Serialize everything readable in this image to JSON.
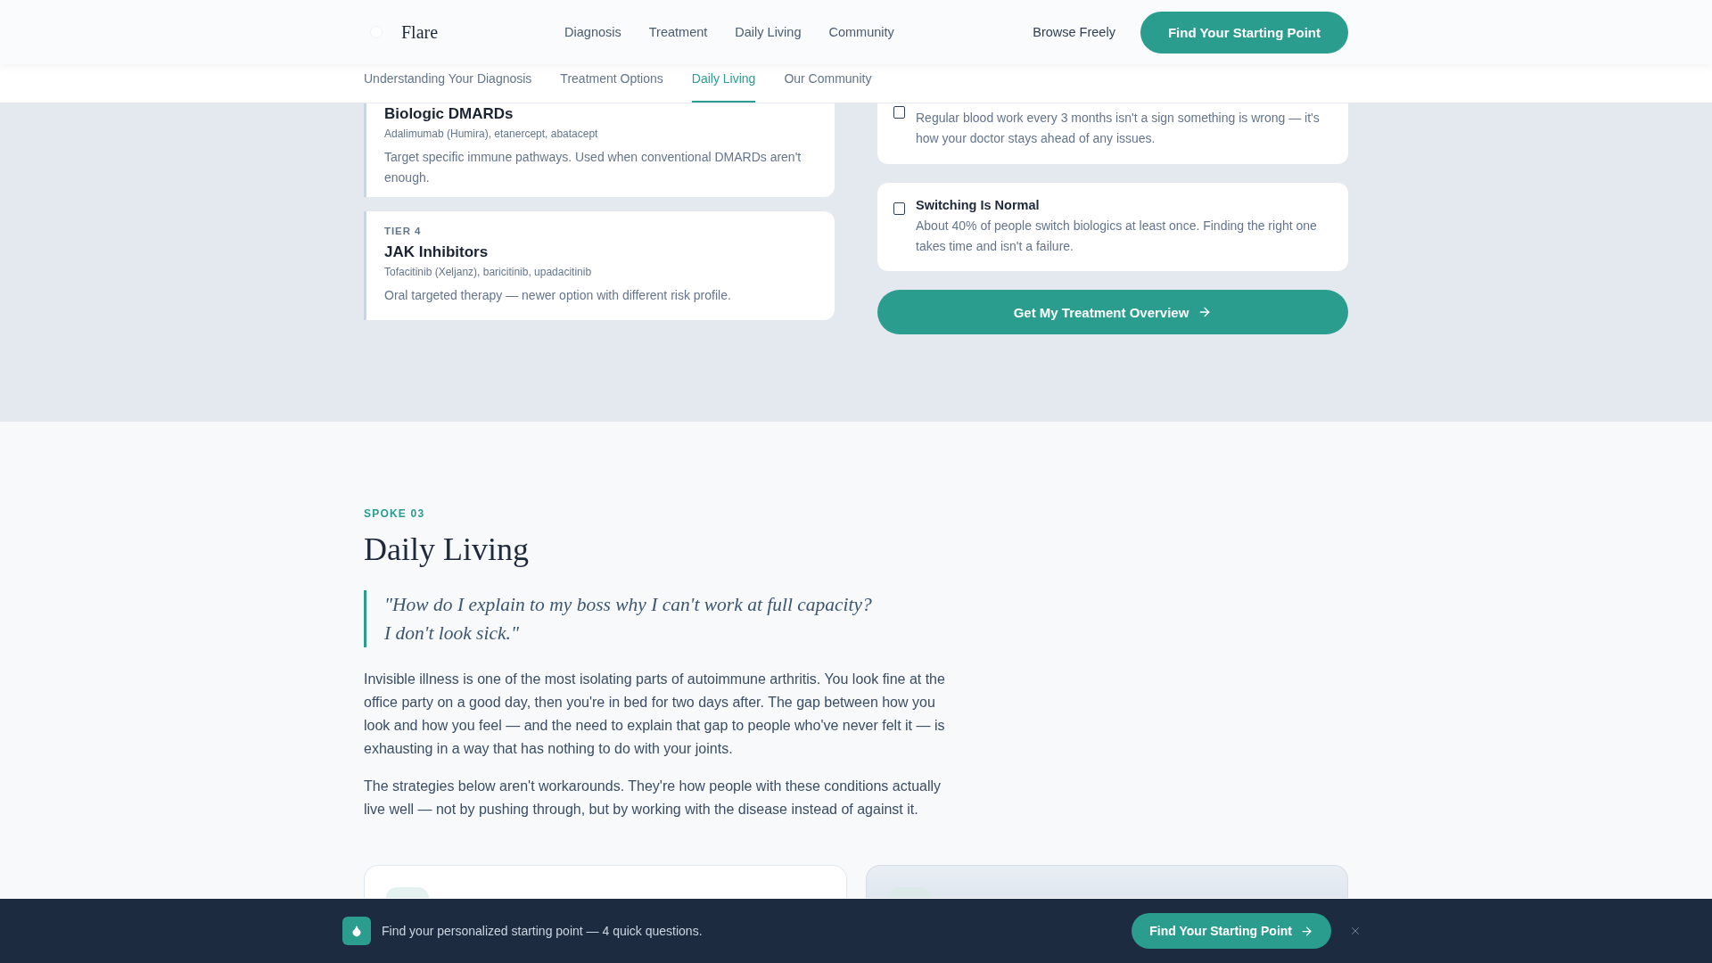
{
  "header": {
    "logo": "Flare",
    "nav": [
      "Diagnosis",
      "Treatment",
      "Daily Living",
      "Community"
    ],
    "browse_link": "Browse Freely",
    "cta": "Find Your Starting Point"
  },
  "subnav": [
    {
      "label": "Understanding Your Diagnosis",
      "selected": false
    },
    {
      "label": "Treatment Options",
      "selected": false
    },
    {
      "label": "Daily Living",
      "selected": true
    },
    {
      "label": "Our Community",
      "selected": false
    }
  ],
  "treatment_tiers": [
    {
      "title": "Biologic DMARDs",
      "drugs": "Adalimumab (Humira), etanercept, abatacept",
      "description": "Target specific immune pathways. Used when conventional DMARDs aren't enough."
    },
    {
      "tier": "TIER 4",
      "title": "JAK Inhibitors",
      "drugs": "Tofacitinib (Xeljanz), baricitinib, upadacitinib",
      "description": "Oral targeted therapy — newer option with different risk profile."
    }
  ],
  "reassurances": [
    {
      "checked": false,
      "description": "Regular blood work every 3 months isn't a sign something is wrong — it's how your doctor stays ahead of any issues."
    },
    {
      "checked": false,
      "title": "Switching Is Normal",
      "description": "About 40% of people switch biologics at least once. Finding the right one takes time and isn't a failure."
    }
  ],
  "overview_button": "Get My Treatment Overview",
  "daily_living": {
    "eyebrow": "SPOKE 03",
    "title": "Daily Living",
    "quote": [
      "\"How do I explain to my boss why I can't work at full capacity?",
      "I don't look sick.\""
    ],
    "paragraphs": [
      "Invisible illness is one of the most isolating parts of autoimmune arthritis. You look fine at the office party on a good day, then you're in bed for two days after. The gap between how you look and how you feel — and the need to explain that gap to people who've never felt it — is exhausting in a way that has nothing to do with your joints.",
      "The strategies below aren't workarounds. They're how people with these conditions actually live well — not by pushing through, but by working with the disease instead of against it."
    ],
    "topic_cards": [
      {
        "highlighted": false
      },
      {
        "highlighted": true
      }
    ]
  },
  "prompt_bar": {
    "text": "Find your personalized starting point — 4 quick questions.",
    "cta": "Find Your Starting Point"
  }
}
